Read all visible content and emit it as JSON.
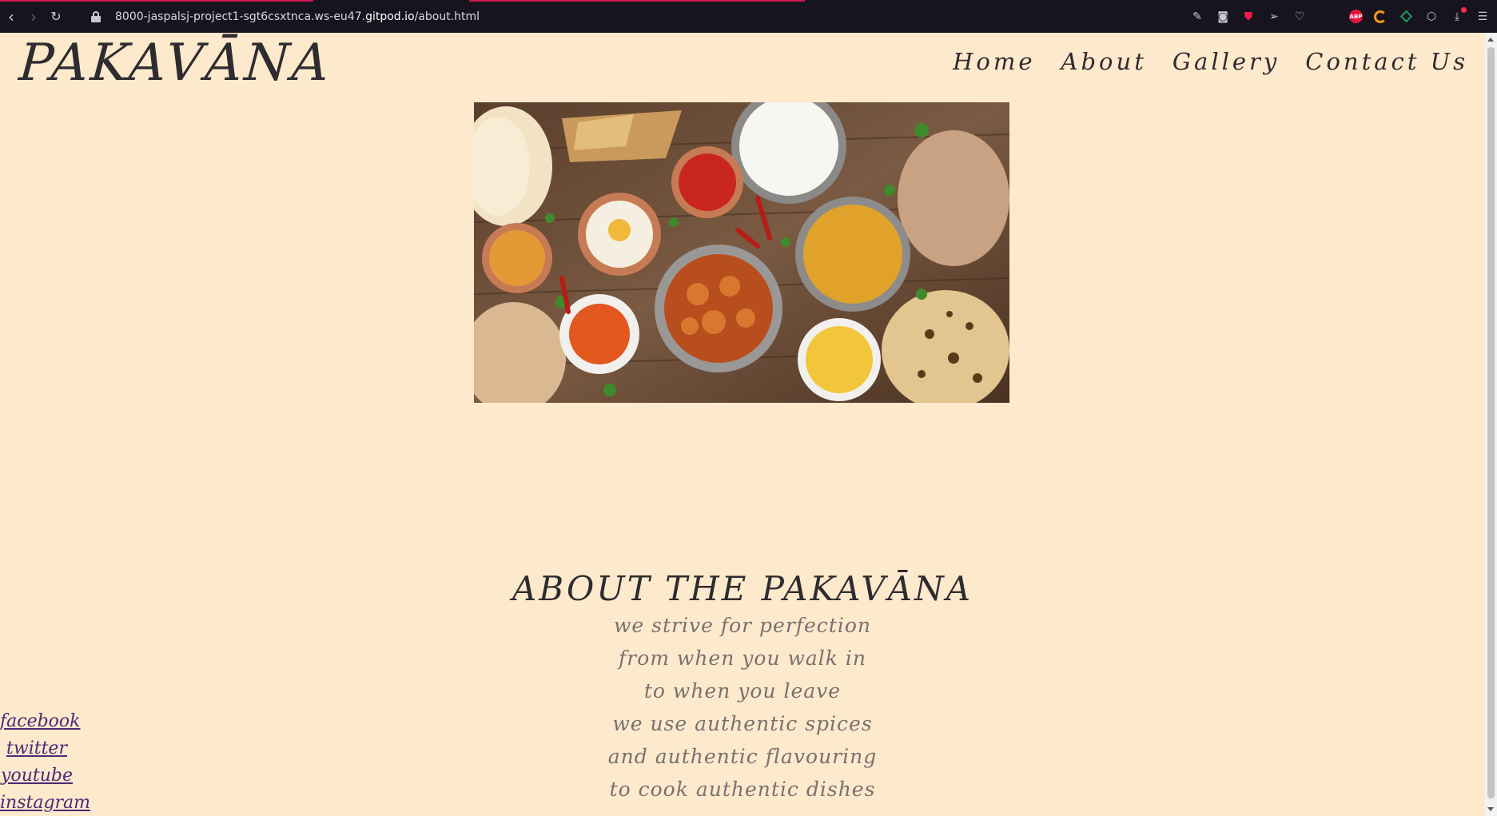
{
  "browser": {
    "url_prefix": "8000-jaspalsj-project1-sgt6csxtnca.ws-eu47.",
    "url_host": "gitpod.io",
    "url_path": "/about.html",
    "abp_label": "ABP"
  },
  "site": {
    "logo": "PAKAVĀNA",
    "nav": [
      "Home",
      "About",
      "Gallery",
      "Contact Us"
    ]
  },
  "about": {
    "title": "ABOUT THE PAKAVĀNA",
    "lines": [
      "we strive for perfection",
      "from when you walk in",
      "to when you leave",
      "we use authentic spices",
      "and authentic flavouring",
      "to cook authentic dishes"
    ]
  },
  "social": [
    "facebook",
    "twitter",
    "youtube",
    "instagram"
  ],
  "colors": {
    "page_bg": "#fde9cc",
    "text_dark": "#2e2c30",
    "text_muted": "#77726f",
    "link": "#4b2a78",
    "chrome_bg": "#17141f"
  }
}
